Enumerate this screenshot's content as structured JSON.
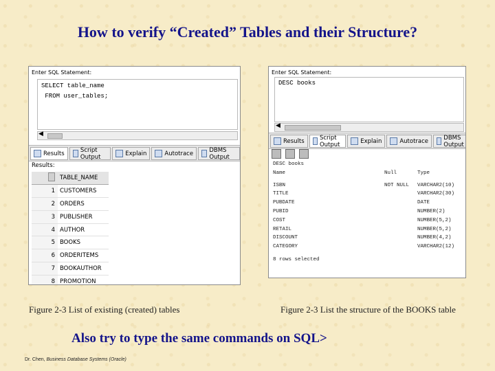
{
  "slide": {
    "title": "How to verify “Created” Tables and their Structure?",
    "subline": "Also try to type the same commands on SQL>",
    "footer_author": "Dr. Chen, ",
    "footer_course": "Business Database Systems (Oracle)"
  },
  "left_figure": {
    "enter_label": "Enter SQL Statement:",
    "sql_lines": [
      "SELECT table_name",
      " FROM user_tables;"
    ],
    "tabs": [
      "Results",
      "Script Output",
      "Explain",
      "Autotrace",
      "DBMS Output"
    ],
    "active_tab": "Results",
    "results_label": "Results:",
    "column_header": "TABLE_NAME",
    "rows": [
      {
        "n": "1",
        "v": "CUSTOMERS"
      },
      {
        "n": "2",
        "v": "ORDERS"
      },
      {
        "n": "3",
        "v": "PUBLISHER"
      },
      {
        "n": "4",
        "v": "AUTHOR"
      },
      {
        "n": "5",
        "v": "BOOKS"
      },
      {
        "n": "6",
        "v": "ORDERITEMS"
      },
      {
        "n": "7",
        "v": "BOOKAUTHOR"
      },
      {
        "n": "8",
        "v": "PROMOTION"
      }
    ],
    "caption": "Figure 2-3  List of existing (created) tables"
  },
  "right_figure": {
    "enter_label": "Enter SQL Statement:",
    "sql_lines": [
      "DESC books"
    ],
    "tabs": [
      "Results",
      "Script Output",
      "Explain",
      "Autotrace",
      "DBMS Output"
    ],
    "active_tab": "Script Output",
    "output_header": "DESC books",
    "col_headers": [
      "Name",
      "Null",
      "Type"
    ],
    "rows": [
      {
        "name": "ISBN",
        "null": "NOT NULL",
        "type": "VARCHAR2(10)"
      },
      {
        "name": "TITLE",
        "null": "",
        "type": "VARCHAR2(30)"
      },
      {
        "name": "PUBDATE",
        "null": "",
        "type": "DATE"
      },
      {
        "name": "PUBID",
        "null": "",
        "type": "NUMBER(2)"
      },
      {
        "name": "COST",
        "null": "",
        "type": "NUMBER(5,2)"
      },
      {
        "name": "RETAIL",
        "null": "",
        "type": "NUMBER(5,2)"
      },
      {
        "name": "DISCOUNT",
        "null": "",
        "type": "NUMBER(4,2)"
      },
      {
        "name": "CATEGORY",
        "null": "",
        "type": "VARCHAR2(12)"
      }
    ],
    "footer_text": "8 rows selected",
    "caption": "Figure 2-3  List the structure of the BOOKS table"
  }
}
